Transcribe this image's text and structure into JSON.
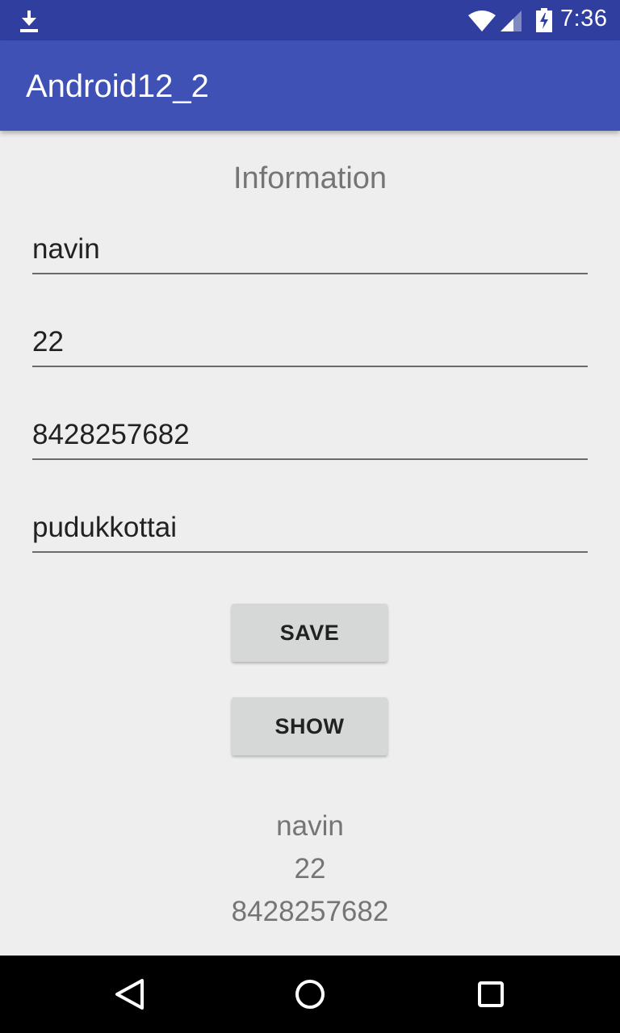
{
  "status_bar": {
    "time": "7:36",
    "icons": [
      "download-icon",
      "wifi-icon",
      "signal-icon",
      "battery-icon"
    ]
  },
  "app_bar": {
    "title": "Android12_2",
    "color": "#3f51b5"
  },
  "form": {
    "heading": "Information",
    "fields": {
      "name": "navin",
      "age": "22",
      "phone": "8428257682",
      "city": "pudukkottai"
    },
    "save_label": "SAVE",
    "show_label": "SHOW"
  },
  "output": {
    "lines": [
      "navin",
      "22",
      "8428257682"
    ]
  },
  "nav_bar": {
    "buttons": [
      "back-icon",
      "home-icon",
      "recents-icon"
    ]
  }
}
